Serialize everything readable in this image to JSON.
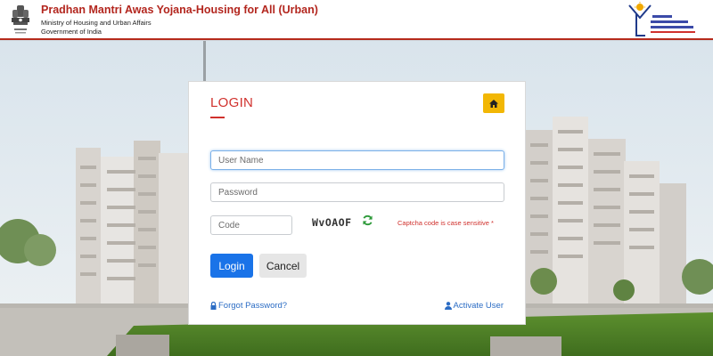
{
  "header": {
    "title": "Pradhan Mantri Awas Yojana-Housing for All (Urban)",
    "ministry": "Ministry of Housing and Urban Affairs",
    "government": "Government of India",
    "emblem_icon": "national-emblem",
    "logo_icon": "pmay-logo",
    "accent_color": "#b3261e"
  },
  "login": {
    "title": "LOGIN",
    "home_icon": "home-icon",
    "username": {
      "value": "",
      "placeholder": "User Name"
    },
    "password": {
      "value": "",
      "placeholder": "Password"
    },
    "code": {
      "value": "",
      "placeholder": "Code"
    },
    "captcha": "WvOAOF",
    "refresh_icon": "refresh-icon",
    "captcha_note": "Captcha code is case sensitive *",
    "login_button": "Login",
    "cancel_button": "Cancel",
    "forgot_link": "Forgot Password?",
    "forgot_icon": "lock-icon",
    "activate_link": "Activate User",
    "activate_icon": "user-icon",
    "button_color": "#1a73e8",
    "home_button_color": "#f2b705"
  }
}
